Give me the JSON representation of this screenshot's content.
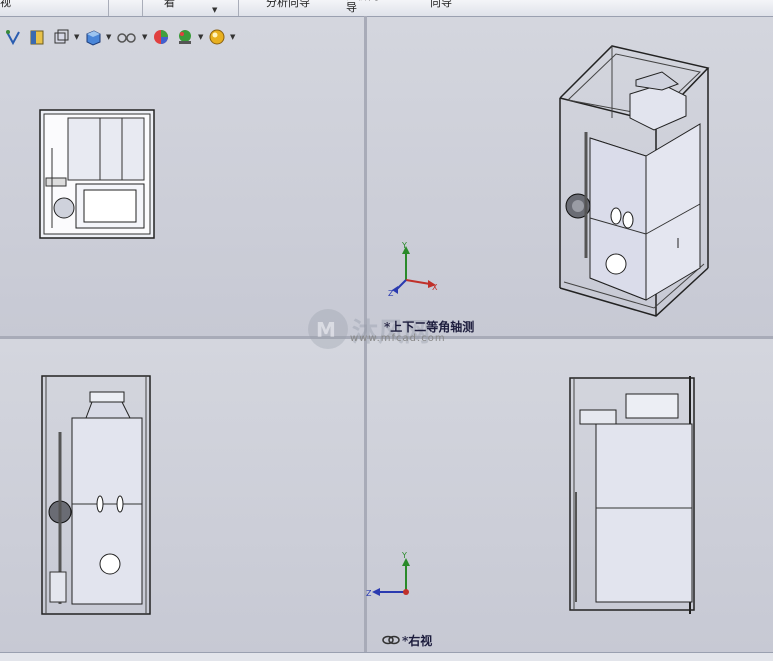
{
  "toolbar_top": {
    "tab_1": "视",
    "tab_2": "看",
    "tab_3": "分析向导",
    "tab_4": "分析向\n导",
    "tab_5": "向导"
  },
  "hud_icons": [
    "view-orientation-icon",
    "section-view-icon",
    "display-style-icon",
    "view-cube-icon",
    "hide-show-icon",
    "appearance-icon",
    "scene-icon",
    "lighting-icon"
  ],
  "viewports": {
    "top_left": {
      "label": ""
    },
    "top_right": {
      "label": "*上下二等角轴测"
    },
    "bottom_left": {
      "label": ""
    },
    "bottom_right": {
      "label": "*右视"
    }
  },
  "triad": {
    "x": "X",
    "y": "Y",
    "z": "Z"
  },
  "watermark": {
    "text": "沐风网",
    "url": "www.mfcad.com"
  },
  "colors": {
    "background": "#c9cbd6",
    "x_axis": "#c0302a",
    "y_axis": "#2a8a2a",
    "z_axis": "#2a3ab0"
  }
}
